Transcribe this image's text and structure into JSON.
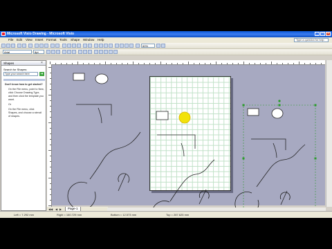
{
  "window": {
    "title": "Microsoft Visio Drawing - Microsoft Visio"
  },
  "menus": [
    "File",
    "Edit",
    "View",
    "Insert",
    "Format",
    "Tools",
    "Shape",
    "Window",
    "Help"
  ],
  "help_box": {
    "placeholder": "Type a question for help"
  },
  "toolbar": {
    "zoom": "60%",
    "font": "Arial",
    "font_size": "8pt"
  },
  "shapes_pane": {
    "title": "Shapes",
    "search_label": "Search for Shapes:",
    "search_placeholder": "Type your search here",
    "tips": {
      "heading": "Don't know how to get started?",
      "items": [
        "On the File menu, point to New, click Choose Drawing Type, and then click the template you want.",
        "Or",
        "On the File menu, click Shapes, and choose a stencil of shapes."
      ]
    }
  },
  "page_tabs": {
    "active": "Page-1"
  },
  "status_bar": {
    "left": "Left = 7.292 mm",
    "right": "Right = 160.729 mm",
    "bottom": "Bottom = 12.573 mm",
    "top": "Top = 287.625 mm"
  },
  "icons": [
    "app-icon",
    "minimize-icon",
    "maximize-icon",
    "close-icon",
    "go-arrow-icon"
  ]
}
